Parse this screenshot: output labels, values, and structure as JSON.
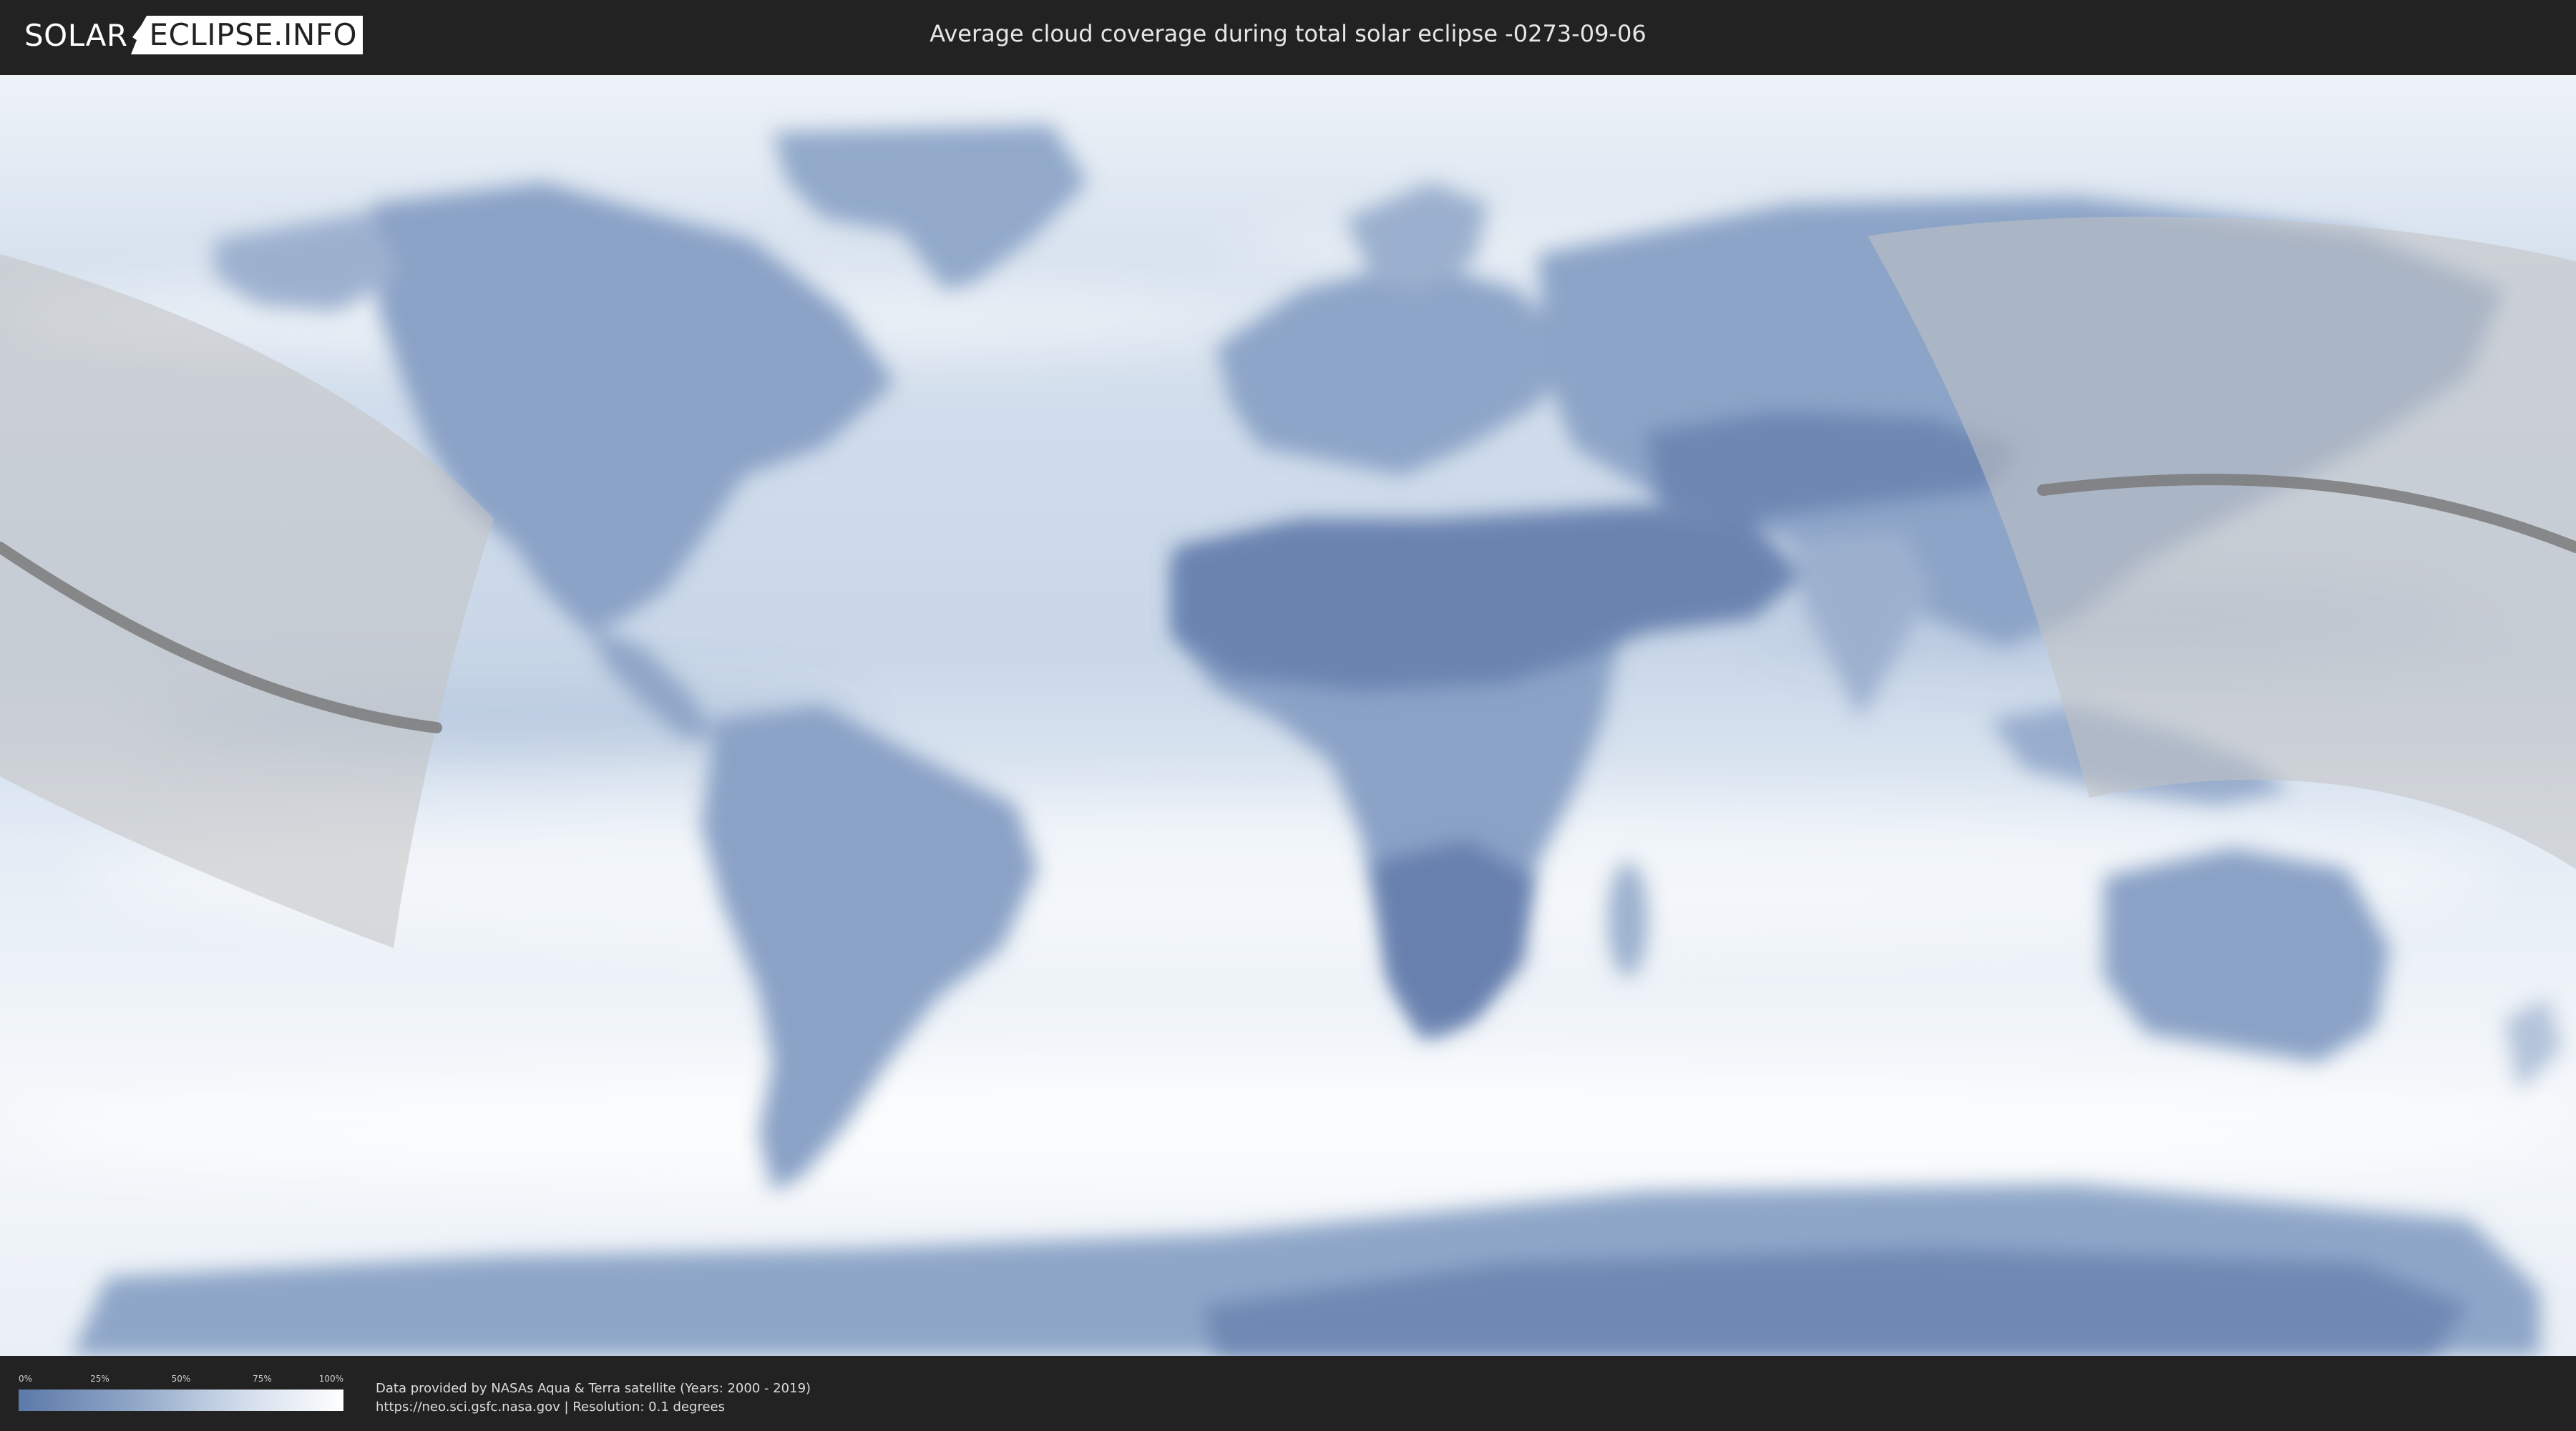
{
  "header": {
    "logo_left": "SOLAR",
    "logo_right": "ECLIPSE.INFO",
    "title": "Average cloud coverage during total solar eclipse -0273-09-06"
  },
  "legend": {
    "ticks": [
      "0%",
      "25%",
      "50%",
      "75%",
      "100%"
    ],
    "tick_fractions": [
      0,
      0.25,
      0.5,
      0.75,
      1
    ],
    "colors": {
      "clear": "#5c79a8",
      "cloudy": "#ffffff"
    }
  },
  "credits": {
    "line1": "Data provided by NASAs Aqua & Terra satellite (Years: 2000 - 2019)",
    "line2": "https://neo.sci.gsfc.nasa.gov | Resolution: 0.1 degrees"
  },
  "map": {
    "ocean_color": "#dbe5f0",
    "land_color": "#7f98c2",
    "dark_land_color": "#5f7aa8",
    "shadow_color": "#b8b8b8",
    "path_color": "#7a7a7a",
    "icons": [
      "eclipse-path-line",
      "eclipse-visibility-zone"
    ]
  }
}
